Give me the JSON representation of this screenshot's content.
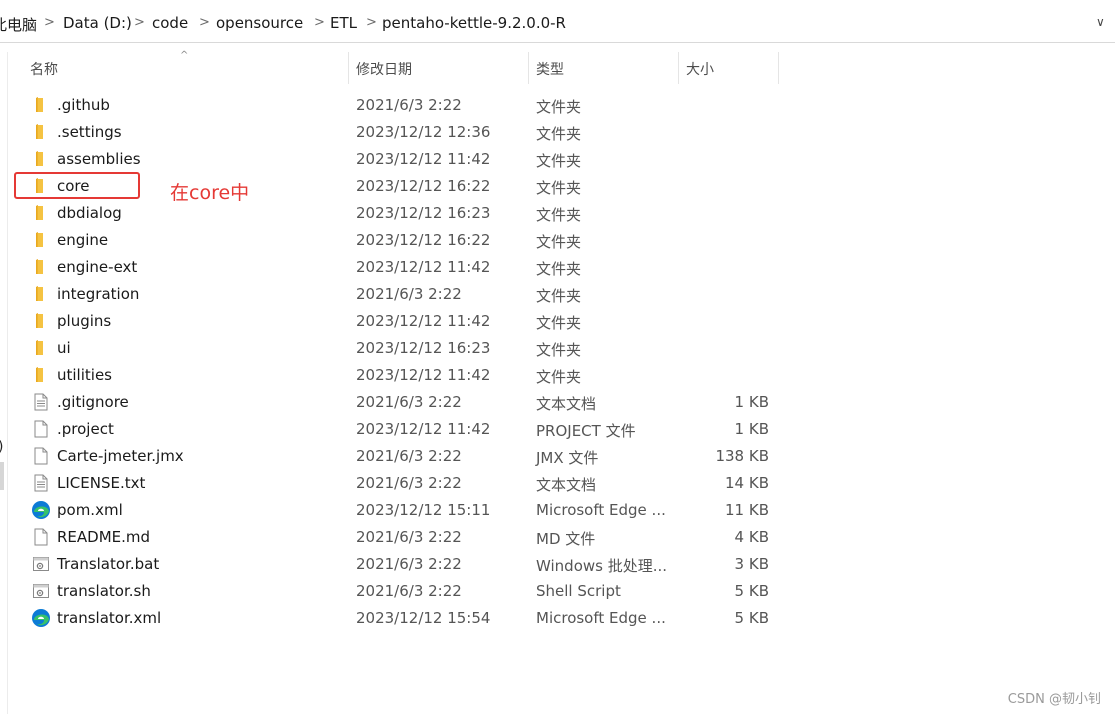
{
  "address_bar": {
    "crumbs": [
      "此电脑",
      "Data (D:)",
      "code",
      "opensource",
      "ETL",
      "pentaho-kettle-9.2.0.0-R"
    ],
    "separator": ">",
    "dropdown": "∨"
  },
  "columns": {
    "name": "名称",
    "date": "修改日期",
    "type": "类型",
    "size": "大小"
  },
  "files": [
    {
      "name": ".github",
      "date": "2021/6/3 2:22",
      "type": "文件夹",
      "size": "",
      "icon": "folder-icon"
    },
    {
      "name": ".settings",
      "date": "2023/12/12 12:36",
      "type": "文件夹",
      "size": "",
      "icon": "folder-icon"
    },
    {
      "name": "assemblies",
      "date": "2023/12/12 11:42",
      "type": "文件夹",
      "size": "",
      "icon": "folder-icon"
    },
    {
      "name": "core",
      "date": "2023/12/12 16:22",
      "type": "文件夹",
      "size": "",
      "icon": "folder-icon"
    },
    {
      "name": "dbdialog",
      "date": "2023/12/12 16:23",
      "type": "文件夹",
      "size": "",
      "icon": "folder-icon"
    },
    {
      "name": "engine",
      "date": "2023/12/12 16:22",
      "type": "文件夹",
      "size": "",
      "icon": "folder-icon"
    },
    {
      "name": "engine-ext",
      "date": "2023/12/12 11:42",
      "type": "文件夹",
      "size": "",
      "icon": "folder-icon"
    },
    {
      "name": "integration",
      "date": "2021/6/3 2:22",
      "type": "文件夹",
      "size": "",
      "icon": "folder-icon"
    },
    {
      "name": "plugins",
      "date": "2023/12/12 11:42",
      "type": "文件夹",
      "size": "",
      "icon": "folder-icon"
    },
    {
      "name": "ui",
      "date": "2023/12/12 16:23",
      "type": "文件夹",
      "size": "",
      "icon": "folder-icon"
    },
    {
      "name": "utilities",
      "date": "2023/12/12 11:42",
      "type": "文件夹",
      "size": "",
      "icon": "folder-icon"
    },
    {
      "name": ".gitignore",
      "date": "2021/6/3 2:22",
      "type": "文本文档",
      "size": "1 KB",
      "icon": "text-file-icon"
    },
    {
      "name": ".project",
      "date": "2023/12/12 11:42",
      "type": "PROJECT 文件",
      "size": "1 KB",
      "icon": "blank-file-icon"
    },
    {
      "name": "Carte-jmeter.jmx",
      "date": "2021/6/3 2:22",
      "type": "JMX 文件",
      "size": "138 KB",
      "icon": "blank-file-icon"
    },
    {
      "name": "LICENSE.txt",
      "date": "2021/6/3 2:22",
      "type": "文本文档",
      "size": "14 KB",
      "icon": "text-file-icon"
    },
    {
      "name": "pom.xml",
      "date": "2023/12/12 15:11",
      "type": "Microsoft Edge ...",
      "size": "11 KB",
      "icon": "edge-icon"
    },
    {
      "name": "README.md",
      "date": "2021/6/3 2:22",
      "type": "MD 文件",
      "size": "4 KB",
      "icon": "blank-file-icon"
    },
    {
      "name": "Translator.bat",
      "date": "2021/6/3 2:22",
      "type": "Windows 批处理...",
      "size": "3 KB",
      "icon": "script-file-icon"
    },
    {
      "name": "translator.sh",
      "date": "2021/6/3 2:22",
      "type": "Shell Script",
      "size": "5 KB",
      "icon": "script-file-icon"
    },
    {
      "name": "translator.xml",
      "date": "2023/12/12 15:54",
      "type": "Microsoft Edge ...",
      "size": "5 KB",
      "icon": "edge-icon"
    }
  ],
  "annotation": {
    "text": "在core中",
    "color": "#e53935"
  },
  "left_pane": {
    "fragment": ")"
  },
  "watermark": "CSDN @韧小钊",
  "colors": {
    "folder": "#f5c342",
    "folder_dark": "#e8a81f",
    "edge_blue": "#0c7bd6",
    "edge_green": "#37c26a",
    "annotation": "#e53935"
  }
}
